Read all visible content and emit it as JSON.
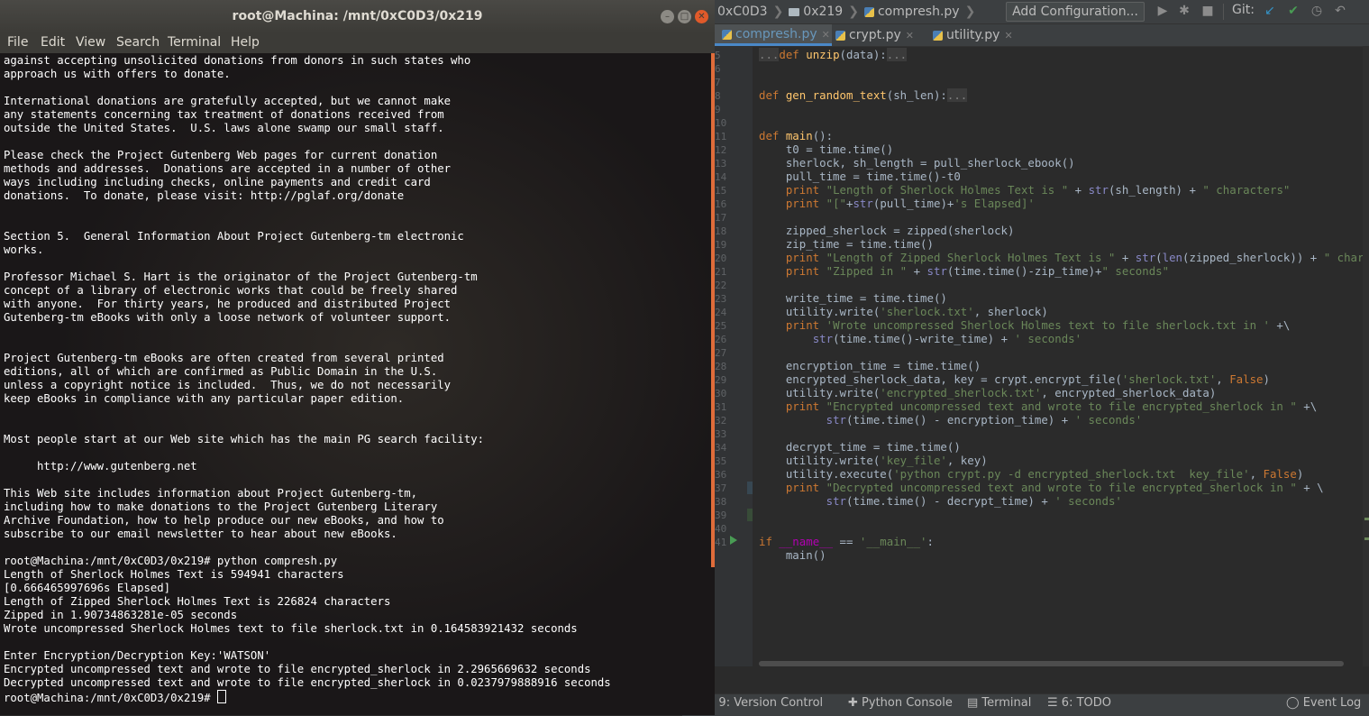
{
  "ide": {
    "breadcrumbs": [
      "0xC0D3",
      "0x219",
      "compresh.py"
    ],
    "add_config_label": "Add Configuration...",
    "git_label": "Git:",
    "tabs": [
      {
        "label": "compresh.py",
        "active": true
      },
      {
        "label": "crypt.py",
        "active": false
      },
      {
        "label": "utility.py",
        "active": false
      }
    ],
    "line_numbers": [
      "5",
      "6",
      "7",
      "8",
      "9",
      "10",
      "11",
      "12",
      "13",
      "14",
      "15",
      "16",
      "17",
      "18",
      "19",
      "20",
      "21",
      "22",
      "23",
      "24",
      "25",
      "26",
      "27",
      "28",
      "29",
      "30",
      "31",
      "32",
      "33",
      "34",
      "35",
      "36",
      "37",
      "38",
      "39",
      "40",
      "41"
    ],
    "code_lines": [
      [
        {
          "c": "fold",
          "t": "..."
        },
        {
          "c": "k",
          "t": "def "
        },
        {
          "c": "f",
          "t": "unzip"
        },
        {
          "c": "",
          "t": "(data):"
        },
        {
          "c": "fold",
          "t": "..."
        }
      ],
      [],
      [],
      [
        {
          "c": "k",
          "t": "def "
        },
        {
          "c": "f",
          "t": "gen_random_text"
        },
        {
          "c": "",
          "t": "(sh_len):"
        },
        {
          "c": "fold",
          "t": "..."
        }
      ],
      [],
      [],
      [
        {
          "c": "k",
          "t": "def "
        },
        {
          "c": "f",
          "t": "main"
        },
        {
          "c": "",
          "t": "():"
        }
      ],
      [
        {
          "c": "",
          "t": "    t0 = time.time()"
        }
      ],
      [
        {
          "c": "",
          "t": "    sherlock, sh_length = pull_sherlock_ebook()"
        }
      ],
      [
        {
          "c": "",
          "t": "    pull_time = time.time()-t0"
        }
      ],
      [
        {
          "c": "k",
          "t": "    print "
        },
        {
          "c": "s",
          "t": "\"Length of Sherlock Holmes Text is \""
        },
        {
          "c": "",
          "t": " + "
        },
        {
          "c": "n",
          "t": "str"
        },
        {
          "c": "",
          "t": "(sh_length) + "
        },
        {
          "c": "s",
          "t": "\" characters\""
        }
      ],
      [
        {
          "c": "k",
          "t": "    print "
        },
        {
          "c": "s",
          "t": "\"[\""
        },
        {
          "c": "",
          "t": "+"
        },
        {
          "c": "n",
          "t": "str"
        },
        {
          "c": "",
          "t": "(pull_time)+"
        },
        {
          "c": "s",
          "t": "'s Elapsed]'"
        }
      ],
      [],
      [
        {
          "c": "",
          "t": "    zipped_sherlock = zipped(sherlock)"
        }
      ],
      [
        {
          "c": "",
          "t": "    zip_time = time.time()"
        }
      ],
      [
        {
          "c": "k",
          "t": "    print "
        },
        {
          "c": "s",
          "t": "\"Length of Zipped Sherlock Holmes Text is \""
        },
        {
          "c": "",
          "t": " + "
        },
        {
          "c": "n",
          "t": "str"
        },
        {
          "c": "",
          "t": "("
        },
        {
          "c": "n",
          "t": "len"
        },
        {
          "c": "",
          "t": "(zipped_sherlock)) + "
        },
        {
          "c": "s",
          "t": "\" characters\""
        }
      ],
      [
        {
          "c": "k",
          "t": "    print "
        },
        {
          "c": "s",
          "t": "\"Zipped in \""
        },
        {
          "c": "",
          "t": " + "
        },
        {
          "c": "n",
          "t": "str"
        },
        {
          "c": "",
          "t": "(time.time()-zip_time)+"
        },
        {
          "c": "s",
          "t": "\" seconds\""
        }
      ],
      [],
      [
        {
          "c": "",
          "t": "    write_time = time.time()"
        }
      ],
      [
        {
          "c": "",
          "t": "    utility.write("
        },
        {
          "c": "s",
          "t": "'sherlock.txt'"
        },
        {
          "c": "",
          "t": ", sherlock)"
        }
      ],
      [
        {
          "c": "k",
          "t": "    print "
        },
        {
          "c": "s",
          "t": "'Wrote uncompressed Sherlock Holmes text to file sherlock.txt in '"
        },
        {
          "c": "",
          "t": " +\\"
        }
      ],
      [
        {
          "c": "",
          "t": "        "
        },
        {
          "c": "n",
          "t": "str"
        },
        {
          "c": "",
          "t": "(time.time()-write_time) + "
        },
        {
          "c": "s",
          "t": "' seconds'"
        }
      ],
      [],
      [
        {
          "c": "",
          "t": "    encryption_time = time.time()"
        }
      ],
      [
        {
          "c": "",
          "t": "    encrypted_sherlock_data, key = crypt.encrypt_file("
        },
        {
          "c": "s",
          "t": "'sherlock.txt'"
        },
        {
          "c": "",
          "t": ", "
        },
        {
          "c": "k",
          "t": "False"
        },
        {
          "c": "",
          "t": ")"
        }
      ],
      [
        {
          "c": "",
          "t": "    utility.write("
        },
        {
          "c": "s",
          "t": "'encrypted_sherlock.txt'"
        },
        {
          "c": "",
          "t": ", encrypted_sherlock_data)"
        }
      ],
      [
        {
          "c": "k",
          "t": "    print "
        },
        {
          "c": "s",
          "t": "\"Encrypted uncompressed text and wrote to file encrypted_sherlock in \""
        },
        {
          "c": "",
          "t": " +\\"
        }
      ],
      [
        {
          "c": "",
          "t": "          "
        },
        {
          "c": "n",
          "t": "str"
        },
        {
          "c": "",
          "t": "(time.time() - encryption_time) + "
        },
        {
          "c": "s",
          "t": "' seconds'"
        }
      ],
      [],
      [
        {
          "c": "",
          "t": "    decrypt_time = time.time()"
        }
      ],
      [
        {
          "c": "",
          "t": "    utility.write("
        },
        {
          "c": "s",
          "t": "'key_file'"
        },
        {
          "c": "",
          "t": ", key)"
        }
      ],
      [
        {
          "c": "",
          "t": "    utility.execute("
        },
        {
          "c": "s",
          "t": "'python crypt.py -d encrypted_sherlock.txt  key_file'"
        },
        {
          "c": "",
          "t": ", "
        },
        {
          "c": "k",
          "t": "False"
        },
        {
          "c": "",
          "t": ")"
        }
      ],
      [
        {
          "c": "k",
          "t": "    print "
        },
        {
          "c": "s",
          "t": "\"Decrypted uncompressed text and wrote to file encrypted_sherlock in \""
        },
        {
          "c": "",
          "t": " + \\"
        }
      ],
      [
        {
          "c": "",
          "t": "          "
        },
        {
          "c": "n",
          "t": "str"
        },
        {
          "c": "",
          "t": "(time.time() - decrypt_time) + "
        },
        {
          "c": "s",
          "t": "' seconds'"
        }
      ],
      [],
      [],
      [
        {
          "c": "k",
          "t": "if "
        },
        {
          "c": "d",
          "t": "__name__"
        },
        {
          "c": "",
          "t": " == "
        },
        {
          "c": "s",
          "t": "'__main__'"
        },
        {
          "c": "",
          "t": ":"
        }
      ],
      [
        {
          "c": "",
          "t": "    main()"
        }
      ]
    ],
    "bottom_bar": {
      "version_control": "9: Version Control",
      "python_console": "Python Console",
      "terminal": "Terminal",
      "todo": "6: TODO",
      "event_log": "Event Log"
    }
  },
  "terminal": {
    "title": "root@Machina: /mnt/0xC0D3/0x219",
    "menu": [
      "File",
      "Edit",
      "View",
      "Search",
      "Terminal",
      "Help"
    ],
    "lines": [
      "against accepting unsolicited donations from donors in such states who",
      "approach us with offers to donate.",
      "",
      "International donations are gratefully accepted, but we cannot make",
      "any statements concerning tax treatment of donations received from",
      "outside the United States.  U.S. laws alone swamp our small staff.",
      "",
      "Please check the Project Gutenberg Web pages for current donation",
      "methods and addresses.  Donations are accepted in a number of other",
      "ways including including checks, online payments and credit card",
      "donations.  To donate, please visit: http://pglaf.org/donate",
      "",
      "",
      "Section 5.  General Information About Project Gutenberg-tm electronic",
      "works.",
      "",
      "Professor Michael S. Hart is the originator of the Project Gutenberg-tm",
      "concept of a library of electronic works that could be freely shared",
      "with anyone.  For thirty years, he produced and distributed Project",
      "Gutenberg-tm eBooks with only a loose network of volunteer support.",
      "",
      "",
      "Project Gutenberg-tm eBooks are often created from several printed",
      "editions, all of which are confirmed as Public Domain in the U.S.",
      "unless a copyright notice is included.  Thus, we do not necessarily",
      "keep eBooks in compliance with any particular paper edition.",
      "",
      "",
      "Most people start at our Web site which has the main PG search facility:",
      "",
      "     http://www.gutenberg.net",
      "",
      "This Web site includes information about Project Gutenberg-tm,",
      "including how to make donations to the Project Gutenberg Literary",
      "Archive Foundation, how to help produce our new eBooks, and how to",
      "subscribe to our email newsletter to hear about new eBooks.",
      "",
      "root@Machina:/mnt/0xC0D3/0x219# python compresh.py",
      "Length of Sherlock Holmes Text is 594941 characters",
      "[0.666465997696s Elapsed]",
      "Length of Zipped Sherlock Holmes Text is 226824 characters",
      "Zipped in 1.90734863281e-05 seconds",
      "Wrote uncompressed Sherlock Holmes text to file sherlock.txt in 0.164583921432 seconds",
      "",
      "Enter Encryption/Decryption Key:'WATSON'",
      "Encrypted uncompressed text and wrote to file encrypted_sherlock in 2.2965669632 seconds",
      "Decrypted uncompressed text and wrote to file encrypted_sherlock in 0.0237979888916 seconds"
    ],
    "prompt": "root@Machina:/mnt/0xC0D3/0x219# "
  }
}
